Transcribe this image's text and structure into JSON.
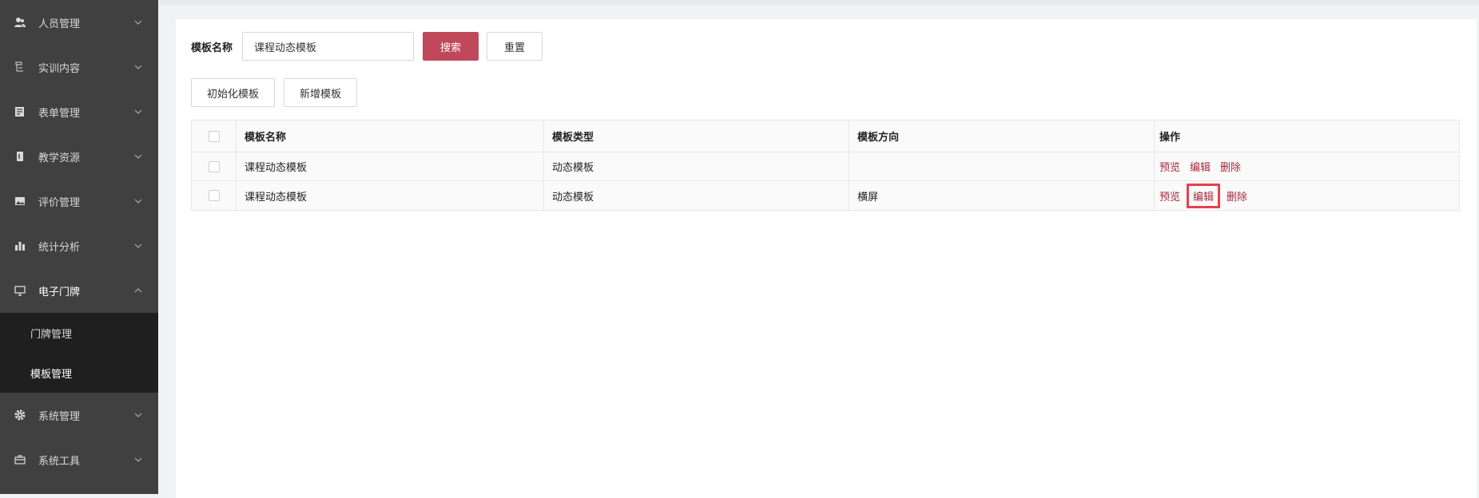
{
  "sidebar": {
    "items": [
      {
        "label": "人员管理",
        "icon": "users-icon"
      },
      {
        "label": "实训内容",
        "icon": "list-icon"
      },
      {
        "label": "表单管理",
        "icon": "form-icon"
      },
      {
        "label": "教学资源",
        "icon": "book-icon"
      },
      {
        "label": "评价管理",
        "icon": "image-icon"
      },
      {
        "label": "统计分析",
        "icon": "bar-chart-icon"
      },
      {
        "label": "电子门牌",
        "icon": "monitor-icon"
      }
    ],
    "submenu": [
      {
        "label": "门牌管理"
      },
      {
        "label": "模板管理"
      }
    ],
    "items_after": [
      {
        "label": "系统管理",
        "icon": "gear-icon"
      },
      {
        "label": "系统工具",
        "icon": "briefcase-icon"
      }
    ]
  },
  "search": {
    "label": "模板名称",
    "value": "课程动态模板",
    "search_button": "搜索",
    "reset_button": "重置"
  },
  "actions": {
    "init_button": "初始化模板",
    "add_button": "新增模板"
  },
  "table": {
    "headers": [
      "模板名称",
      "模板类型",
      "模板方向",
      "操作"
    ],
    "rows": [
      {
        "name": "课程动态模板",
        "type": "动态模板",
        "direction": ""
      },
      {
        "name": "课程动态模板",
        "type": "动态模板",
        "direction": "横屏"
      }
    ],
    "ops": {
      "preview": "预览",
      "edit": "编辑",
      "delete": "删除"
    }
  },
  "colors": {
    "sidebar_bg": "#404040",
    "submenu_bg": "#1f1f1f",
    "primary": "#c0485b",
    "link": "#a8283e",
    "highlight": "#e5404f"
  }
}
